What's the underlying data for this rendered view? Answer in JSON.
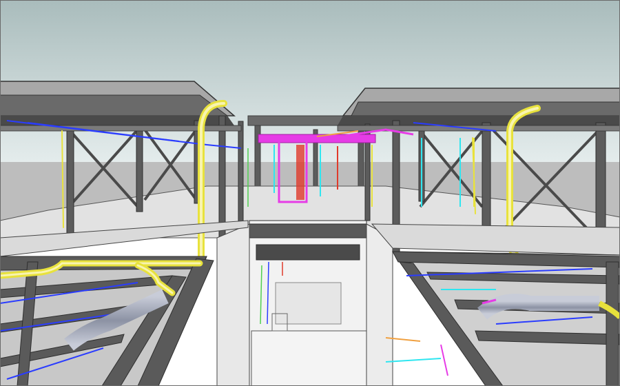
{
  "scene": {
    "kind": "3d-bim-render",
    "description_visible_text": "",
    "colors": {
      "sky_top": "#a9bcbc",
      "sky_mid": "#d8e4e4",
      "horizon_ground": "#bfbfbf",
      "steel": "#5c5c5c",
      "steel_dark": "#3e3e3e",
      "steel_light": "#8a8a8a",
      "slab": "#eeeeee",
      "slab_shade": "#d4d4d4",
      "concrete_wall": "#e6e6e6",
      "yellow_pipe": "#e8e23c",
      "yellow_pipe_light": "#f4f0a0",
      "blue_line": "#2a3cff",
      "magenta_duct": "#e63ce6",
      "cyan_line": "#2ee6f0",
      "red_line": "#e03a2a",
      "orange_line": "#f0a040",
      "green_line": "#4ecf4e",
      "duct_grey": "#9aa0b0"
    }
  }
}
